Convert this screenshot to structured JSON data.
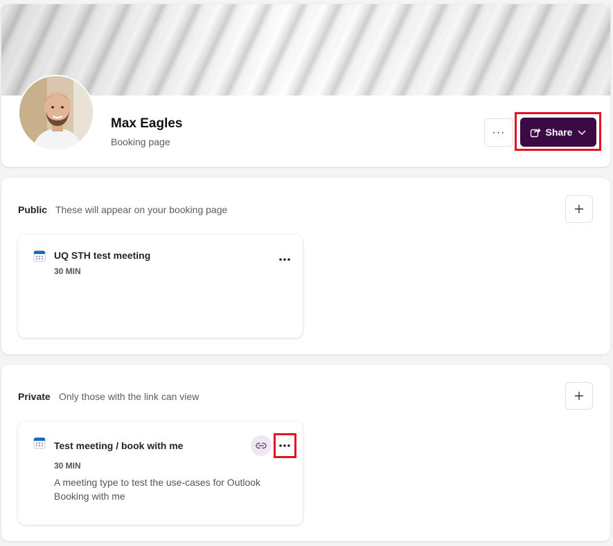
{
  "profile": {
    "name": "Max Eagles",
    "subtitle": "Booking page",
    "more_label": "···",
    "share_label": "Share"
  },
  "sections": {
    "public": {
      "title": "Public",
      "description": "These will appear on your booking page",
      "meetings": [
        {
          "title": "UQ STH test meeting",
          "duration": "30 MIN"
        }
      ]
    },
    "private": {
      "title": "Private",
      "description": "Only those with the link can view",
      "meetings": [
        {
          "title": "Test meeting / book with me",
          "duration": "30 MIN",
          "description": "A meeting type to test the use-cases for Outlook Booking with me"
        }
      ]
    }
  },
  "colors": {
    "accent": "#3b0a45",
    "highlight": "#e0141e",
    "calendar_icon": "#0f6cbd",
    "link_bg": "#f1e6f6"
  },
  "icons": {
    "share": "share-icon",
    "chevron": "chevron-down-icon",
    "add": "plus-icon",
    "calendar": "calendar-icon",
    "more": "more-horizontal-icon",
    "link": "link-icon"
  }
}
